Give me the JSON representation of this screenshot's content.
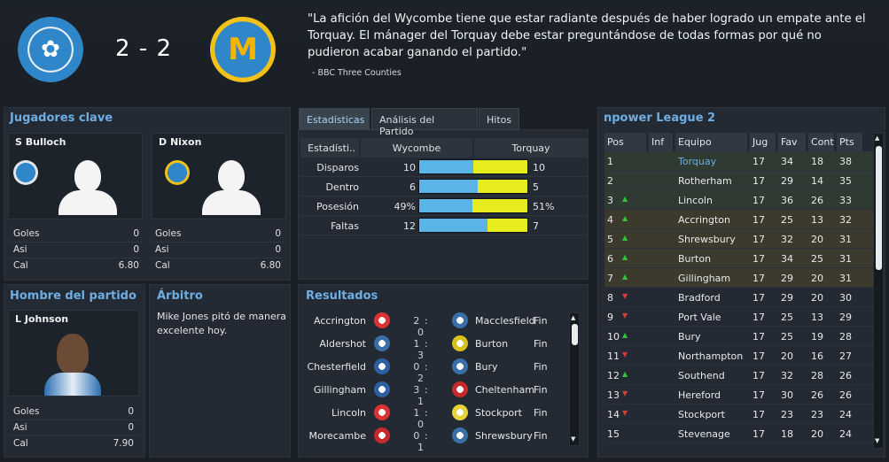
{
  "header": {
    "score": "2 - 2",
    "quote": "\"La afición del Wycombe tiene que estar radiante después de haber logrado un empate ante el Torquay. El mánager del Torquay debe estar preguntándose de todas formas por qué no pudieron acabar ganando el partido.\"",
    "quote_source": "- BBC Three Counties"
  },
  "key_players": {
    "title": "Jugadores clave",
    "players": [
      {
        "name": "S Bulloch",
        "goals_label": "Goles",
        "goals": "0",
        "assists_label": "Asi",
        "assists": "0",
        "rating_label": "Cal",
        "rating": "6.80"
      },
      {
        "name": "D Nixon",
        "goals_label": "Goles",
        "goals": "0",
        "assists_label": "Asi",
        "assists": "0",
        "rating_label": "Cal",
        "rating": "6.80"
      }
    ]
  },
  "motm": {
    "title": "Hombre del partido",
    "name": "L Johnson",
    "goals_label": "Goles",
    "goals": "0",
    "assists_label": "Asi",
    "assists": "0",
    "rating_label": "Cal",
    "rating": "7.90"
  },
  "referee": {
    "title": "Árbitro",
    "text": "Mike Jones pitó de manera excelente hoy."
  },
  "tabs": [
    {
      "label": "Estadísticas"
    },
    {
      "label": "Análisis del Partido"
    },
    {
      "label": "Hitos"
    }
  ],
  "stats": {
    "head_label": "Estadísti..",
    "home": "Wycombe",
    "away": "Torquay",
    "rows": [
      {
        "label": "Disparos",
        "home": "10",
        "away": "10",
        "home_share": 0.5
      },
      {
        "label": "Dentro",
        "home": "6",
        "away": "5",
        "home_share": 0.545
      },
      {
        "label": "Posesión",
        "home": "49%",
        "away": "51%",
        "home_share": 0.49
      },
      {
        "label": "Faltas",
        "home": "12",
        "away": "7",
        "home_share": 0.63
      }
    ]
  },
  "results": {
    "title": "Resultados",
    "rows": [
      {
        "home": "Accrington",
        "score": "2 : 0",
        "away": "Macclesfield",
        "state": "Fin"
      },
      {
        "home": "Aldershot",
        "score": "1 : 3",
        "away": "Burton",
        "state": "Fin"
      },
      {
        "home": "Chesterfield",
        "score": "0 : 2",
        "away": "Bury",
        "state": "Fin"
      },
      {
        "home": "Gillingham",
        "score": "3 : 1",
        "away": "Cheltenham",
        "state": "Fin"
      },
      {
        "home": "Lincoln",
        "score": "1 : 0",
        "away": "Stockport",
        "state": "Fin"
      },
      {
        "home": "Morecambe",
        "score": "0 : 1",
        "away": "Shrewsbury",
        "state": "Fin"
      }
    ]
  },
  "league": {
    "title": "npower League 2",
    "columns": [
      "Pos",
      "Inf",
      "Equipo",
      "Jug",
      "Fav",
      "Cont",
      "Pts"
    ],
    "rows": [
      {
        "pos": "1",
        "trend": "",
        "team": "Torquay",
        "pj": "17",
        "gf": "34",
        "gc": "18",
        "pts": "38"
      },
      {
        "pos": "2",
        "trend": "",
        "team": "Rotherham",
        "pj": "17",
        "gf": "29",
        "gc": "14",
        "pts": "35"
      },
      {
        "pos": "3",
        "trend": "up",
        "team": "Lincoln",
        "pj": "17",
        "gf": "36",
        "gc": "26",
        "pts": "33"
      },
      {
        "pos": "4",
        "trend": "up",
        "team": "Accrington",
        "pj": "17",
        "gf": "25",
        "gc": "13",
        "pts": "32"
      },
      {
        "pos": "5",
        "trend": "up",
        "team": "Shrewsbury",
        "pj": "17",
        "gf": "32",
        "gc": "20",
        "pts": "31"
      },
      {
        "pos": "6",
        "trend": "up",
        "team": "Burton",
        "pj": "17",
        "gf": "34",
        "gc": "25",
        "pts": "31"
      },
      {
        "pos": "7",
        "trend": "up",
        "team": "Gillingham",
        "pj": "17",
        "gf": "29",
        "gc": "20",
        "pts": "31"
      },
      {
        "pos": "8",
        "trend": "down",
        "team": "Bradford",
        "pj": "17",
        "gf": "29",
        "gc": "20",
        "pts": "30"
      },
      {
        "pos": "9",
        "trend": "down",
        "team": "Port Vale",
        "pj": "17",
        "gf": "25",
        "gc": "13",
        "pts": "29"
      },
      {
        "pos": "10",
        "trend": "up",
        "team": "Bury",
        "pj": "17",
        "gf": "25",
        "gc": "19",
        "pts": "28"
      },
      {
        "pos": "11",
        "trend": "down",
        "team": "Northampton",
        "pj": "17",
        "gf": "20",
        "gc": "16",
        "pts": "27"
      },
      {
        "pos": "12",
        "trend": "up",
        "team": "Southend",
        "pj": "17",
        "gf": "32",
        "gc": "28",
        "pts": "26"
      },
      {
        "pos": "13",
        "trend": "down",
        "team": "Hereford",
        "pj": "17",
        "gf": "30",
        "gc": "26",
        "pts": "26"
      },
      {
        "pos": "14",
        "trend": "down",
        "team": "Stockport",
        "pj": "17",
        "gf": "23",
        "gc": "23",
        "pts": "24"
      },
      {
        "pos": "15",
        "trend": "",
        "team": "Stevenage",
        "pj": "17",
        "gf": "18",
        "gc": "20",
        "pts": "24"
      }
    ]
  },
  "colors": {
    "accent": "#6eaee3",
    "home_bar": "#5ab4e6",
    "away_bar": "#e7ec1d",
    "highlight_team": "#6eaee3",
    "promo_row": "#2f3a32",
    "playoff_row": "#3b3a2c",
    "trend_up": "#36c13c",
    "trend_down": "#d63b36"
  }
}
